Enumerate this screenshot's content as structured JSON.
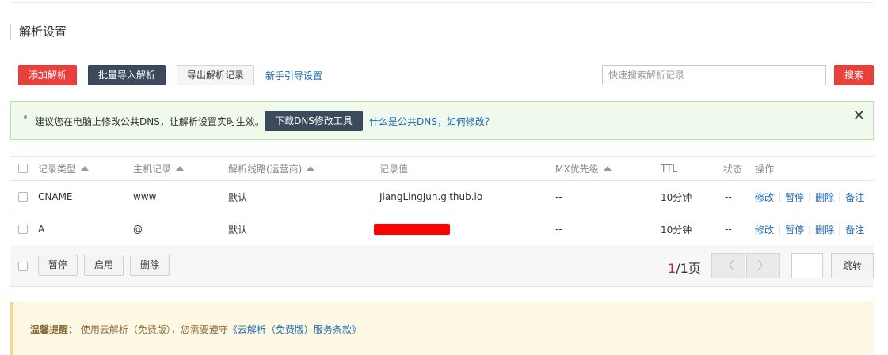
{
  "page": {
    "title": "解析设置"
  },
  "toolbar": {
    "add_label": "添加解析",
    "batch_import_label": "批量导入解析",
    "export_label": "导出解析记录",
    "guide_label": "新手引导设置",
    "search_placeholder": "快速搜索解析记录",
    "search_label": "搜索"
  },
  "notice": {
    "text": "建议您在电脑上修改公共DNS，让解析设置实时生效。",
    "download_label": "下载DNS修改工具",
    "link_label": "什么是公共DNS，如何修改？",
    "close_glyph": "✕"
  },
  "table": {
    "headers": {
      "type": "记录类型",
      "host": "主机记录",
      "line": "解析线路(运营商)",
      "value": "记录值",
      "mx": "MX优先级",
      "ttl": "TTL",
      "status": "状态",
      "ops": "操作"
    },
    "rows": [
      {
        "type": "CNAME",
        "host": "www",
        "line": "默认",
        "value": "JiangLingJun.github.io",
        "mx": "--",
        "ttl": "10分钟",
        "status": "--"
      },
      {
        "type": "A",
        "host": "@",
        "line": "默认",
        "value": "",
        "mx": "--",
        "ttl": "10分钟",
        "status": "--"
      }
    ],
    "ops": {
      "edit": "修改",
      "pause": "暂停",
      "delete": "删除",
      "note": "备注",
      "sep": "|"
    }
  },
  "footer": {
    "pause_label": "暂停",
    "enable_label": "启用",
    "delete_label": "删除",
    "page_current": "1",
    "page_total": "/1页",
    "prev_glyph": "〈",
    "next_glyph": "〉",
    "jump_label": "跳转"
  },
  "tip": {
    "label": "温馨提醒：",
    "text": " 使用云解析（免费版），您需要遵守",
    "link": "《云解析（免费版）服务条款》"
  },
  "colors": {
    "accent_red": "#e9403c",
    "dark_button": "#3c4a5c",
    "link_blue": "#1e6ab7",
    "redaction": "#ff0000"
  }
}
